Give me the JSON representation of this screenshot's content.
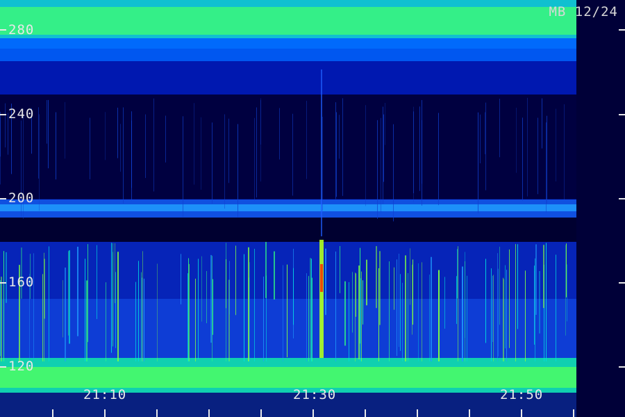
{
  "spectrogram": {
    "stamp": "MB 12/24",
    "y_axis_labels": [
      "280",
      "240",
      "200",
      "160",
      "120"
    ],
    "x_axis_labels": [
      "21:10",
      "21:30",
      "21:50"
    ],
    "colormap": [
      "#000033",
      "#0000a0",
      "#0033ff",
      "#00a0ff",
      "#00e0e0",
      "#30ff80",
      "#b0ff20",
      "#ff2000"
    ],
    "label_color": "#e8e8e8"
  }
}
